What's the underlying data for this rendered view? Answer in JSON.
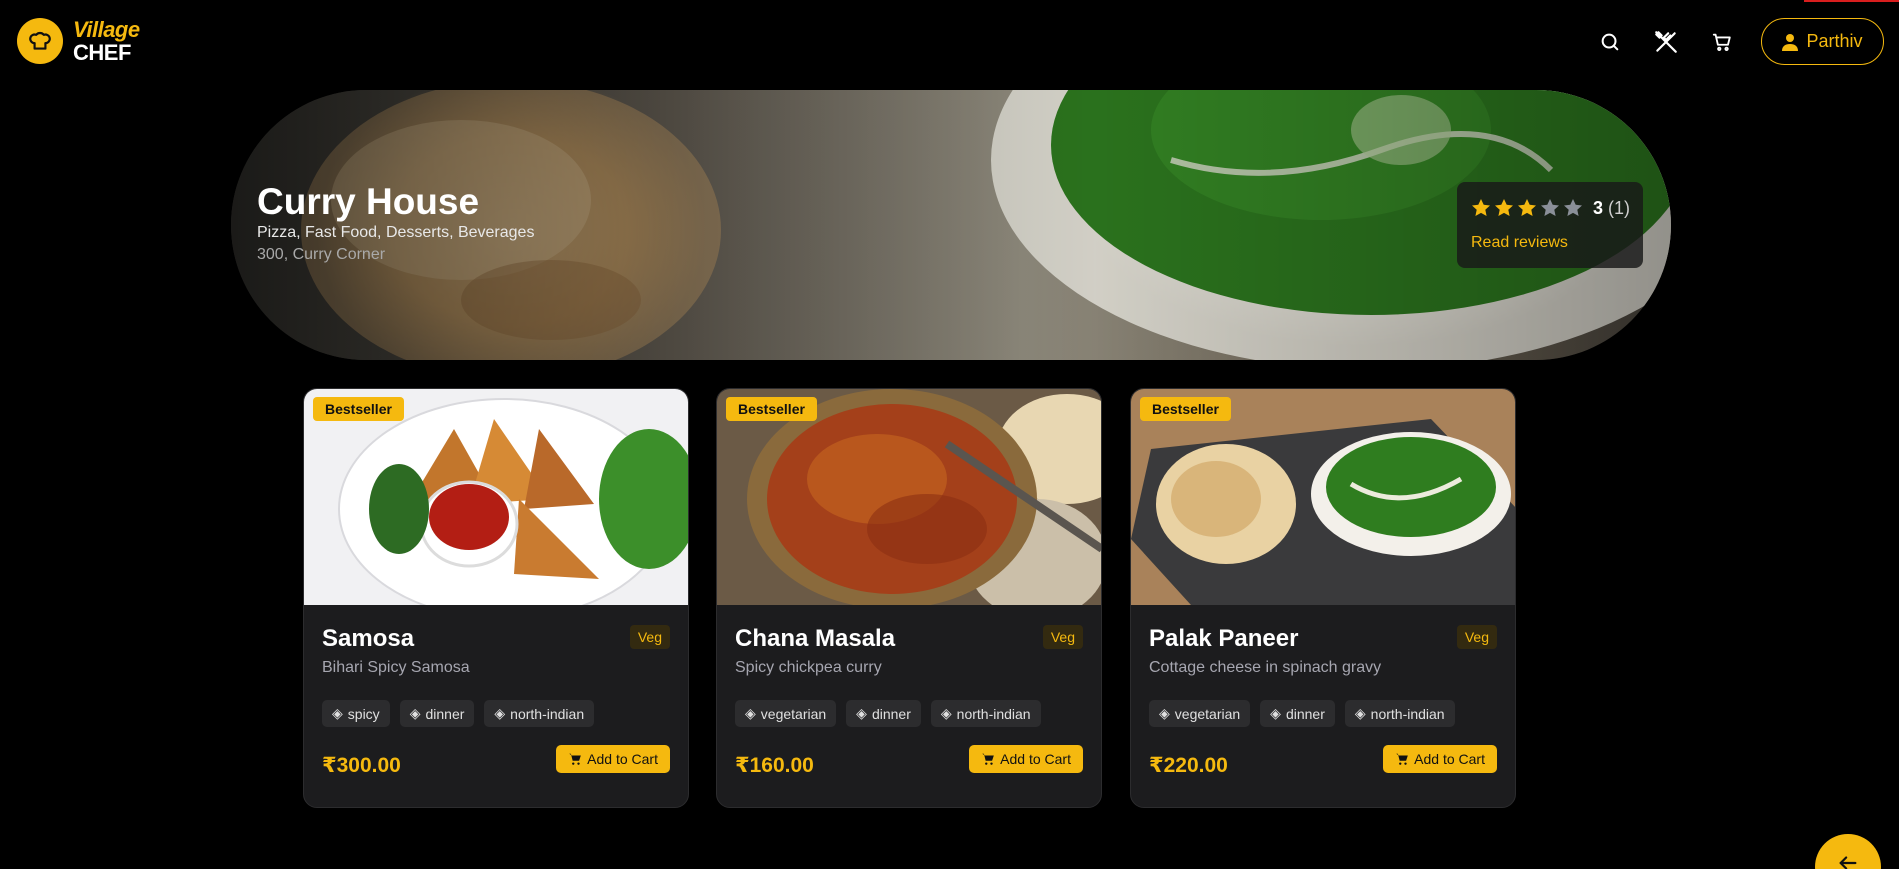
{
  "brand": {
    "line1": "Village",
    "line2": "CHEF",
    "accent": "#f5b90f"
  },
  "nav": {
    "icons": [
      "search-icon",
      "utensils-icon",
      "cart-icon"
    ],
    "user_name": "Parthiv"
  },
  "restaurant": {
    "name": "Curry House",
    "cuisines": "Pizza, Fast Food, Desserts, Beverages",
    "address": "300, Curry Corner",
    "rating": "3",
    "rating_value": 3,
    "rating_max": 5,
    "review_count": "(1)",
    "read_reviews": "Read reviews"
  },
  "dishes": [
    {
      "badge": "Bestseller",
      "name": "Samosa",
      "diet": "Veg",
      "description": "Bihari Spicy Samosa",
      "tags": [
        "spicy",
        "dinner",
        "north-indian"
      ],
      "price": "₹300.00",
      "cta": "Add to Cart"
    },
    {
      "badge": "Bestseller",
      "name": "Chana Masala",
      "diet": "Veg",
      "description": "Spicy chickpea curry",
      "tags": [
        "vegetarian",
        "dinner",
        "north-indian"
      ],
      "price": "₹160.00",
      "cta": "Add to Cart"
    },
    {
      "badge": "Bestseller",
      "name": "Palak Paneer",
      "diet": "Veg",
      "description": "Cottage cheese in spinach gravy",
      "tags": [
        "vegetarian",
        "dinner",
        "north-indian"
      ],
      "price": "₹220.00",
      "cta": "Add to Cart"
    }
  ]
}
